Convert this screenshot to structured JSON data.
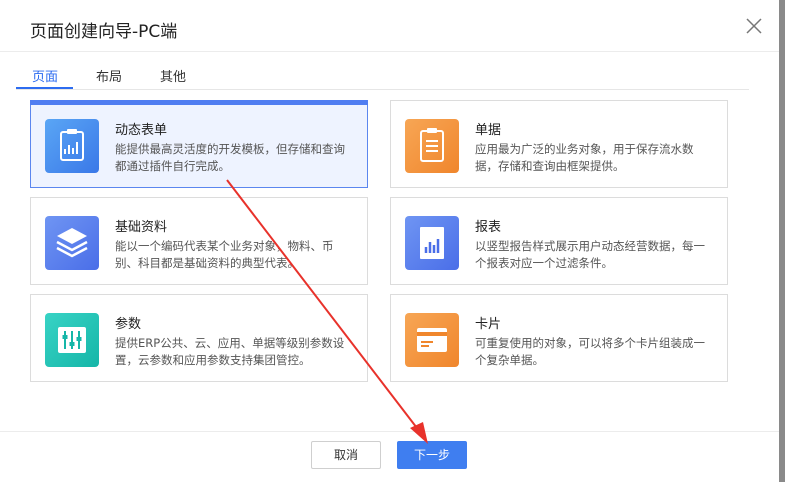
{
  "dialog": {
    "title": "页面创建向导-PC端",
    "tabs": [
      {
        "label": "页面",
        "active": true
      },
      {
        "label": "布局",
        "active": false
      },
      {
        "label": "其他",
        "active": false
      }
    ],
    "cards": [
      {
        "name": "动态表单",
        "desc": "能提供最高灵活度的开发模板，但存储和查询都通过插件自行完成。",
        "icon": "dynamic-form-icon",
        "selected": true
      },
      {
        "name": "单据",
        "desc": "应用最为广泛的业务对象，用于保存流水数据，存储和查询由框架提供。",
        "icon": "bill-icon",
        "selected": false
      },
      {
        "name": "基础资料",
        "desc": "能以一个编码代表某个业务对象，物料、币别、科目都是基础资料的典型代表。",
        "icon": "base-data-icon",
        "selected": false
      },
      {
        "name": "报表",
        "desc": "以竖型报告样式展示用户动态经营数据，每一个报表对应一个过滤条件。",
        "icon": "report-icon",
        "selected": false
      },
      {
        "name": "参数",
        "desc": "提供ERP公共、云、应用、单据等级别参数设置，云参数和应用参数支持集团管控。",
        "icon": "parameter-icon",
        "selected": false
      },
      {
        "name": "卡片",
        "desc": "可重复使用的对象，可以将多个卡片组装成一个复杂单据。",
        "icon": "card-icon",
        "selected": false
      }
    ],
    "buttons": {
      "cancel": "取消",
      "next": "下一步"
    }
  },
  "colors": {
    "accent": "#3f7ef0",
    "annotation_arrow": "#e8322b"
  }
}
